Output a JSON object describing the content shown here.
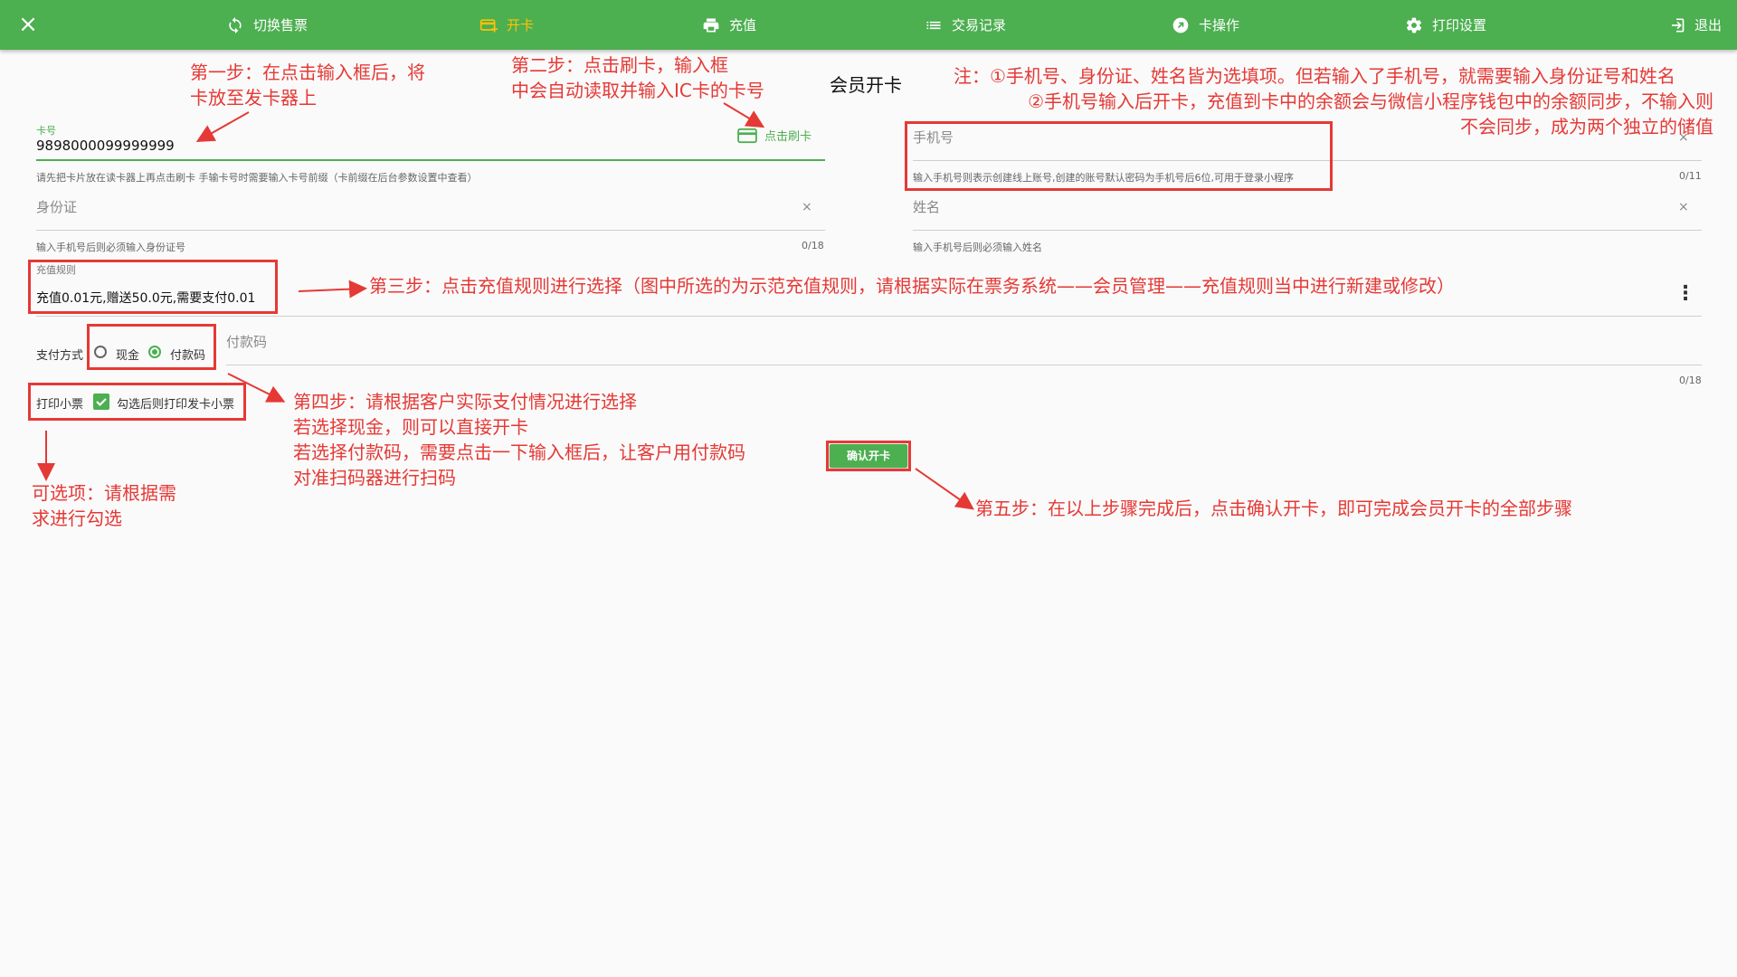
{
  "topbar": {
    "items": [
      {
        "label": "切换售票",
        "icon": "refresh-icon"
      },
      {
        "label": "开卡",
        "icon": "card-add-icon",
        "active": true
      },
      {
        "label": "充值",
        "icon": "printer-icon"
      },
      {
        "label": "交易记录",
        "icon": "list-icon"
      },
      {
        "label": "卡操作",
        "icon": "arrow-circle-icon"
      },
      {
        "label": "打印设置",
        "icon": "gear-icon"
      },
      {
        "label": "退出",
        "icon": "exit-icon"
      }
    ],
    "close_icon": "×"
  },
  "page_title": "会员开卡",
  "card": {
    "label": "卡号",
    "value": "9898000099999999",
    "swipe_label": "点击刷卡",
    "hint": "请先把卡片放在读卡器上再点击刷卡 手输卡号时需要输入卡号前缀（卡前缀在后台参数设置中查看）"
  },
  "id_card": {
    "placeholder": "身份证",
    "hint": "输入手机号后则必须输入身份证号",
    "counter": "0/18",
    "clear": "×"
  },
  "phone": {
    "placeholder": "手机号",
    "hint": "输入手机号则表示创建线上账号,创建的账号默认密码为手机号后6位,可用于登录小程序",
    "counter": "0/11",
    "clear": "×"
  },
  "name": {
    "placeholder": "姓名",
    "hint": "输入手机号后则必须输入姓名",
    "clear": "×"
  },
  "recharge_rule": {
    "label": "充值规则",
    "value": "充值0.01元,赠送50.0元,需要支付0.01"
  },
  "payment": {
    "label": "支付方式",
    "options": [
      {
        "label": "现金",
        "checked": false
      },
      {
        "label": "付款码",
        "checked": true
      }
    ],
    "code_placeholder": "付款码",
    "code_counter": "0/18"
  },
  "print": {
    "label": "打印小票",
    "checkbox_label": "勾选后则打印发卡小票",
    "checked": true
  },
  "confirm_label": "确认开卡",
  "annotations": {
    "step1": [
      "第一步：在点击输入框后，将",
      "卡放至发卡器上"
    ],
    "step2": [
      "第二步：点击刷卡，输入框",
      "中会自动读取并输入IC卡的卡号"
    ],
    "note": [
      "注：①手机号、身份证、姓名皆为选填项。但若输入了手机号，就需要输入身份证号和姓名",
      "②手机号输入后开卡，充值到卡中的余额会与微信小程序钱包中的余额同步，不输入则",
      "不会同步，成为两个独立的储值"
    ],
    "step3": "第三步：点击充值规则进行选择（图中所选的为示范充值规则，请根据实际在票务系统——会员管理——充值规则当中进行新建或修改）",
    "step4": [
      "第四步：请根据客户实际支付情况进行选择",
      "若选择现金，则可以直接开卡",
      "若选择付款码，需要点击一下输入框后，让客户用付款码",
      "对准扫码器进行扫码"
    ],
    "optional": [
      "可选项：请根据需",
      "求进行勾选"
    ],
    "step5": "第五步：在以上步骤完成后，点击确认开卡，即可完成会员开卡的全部步骤"
  },
  "colors": {
    "primary": "#4caf50",
    "active_nav": "#ffc107",
    "annotation": "#e53935"
  }
}
